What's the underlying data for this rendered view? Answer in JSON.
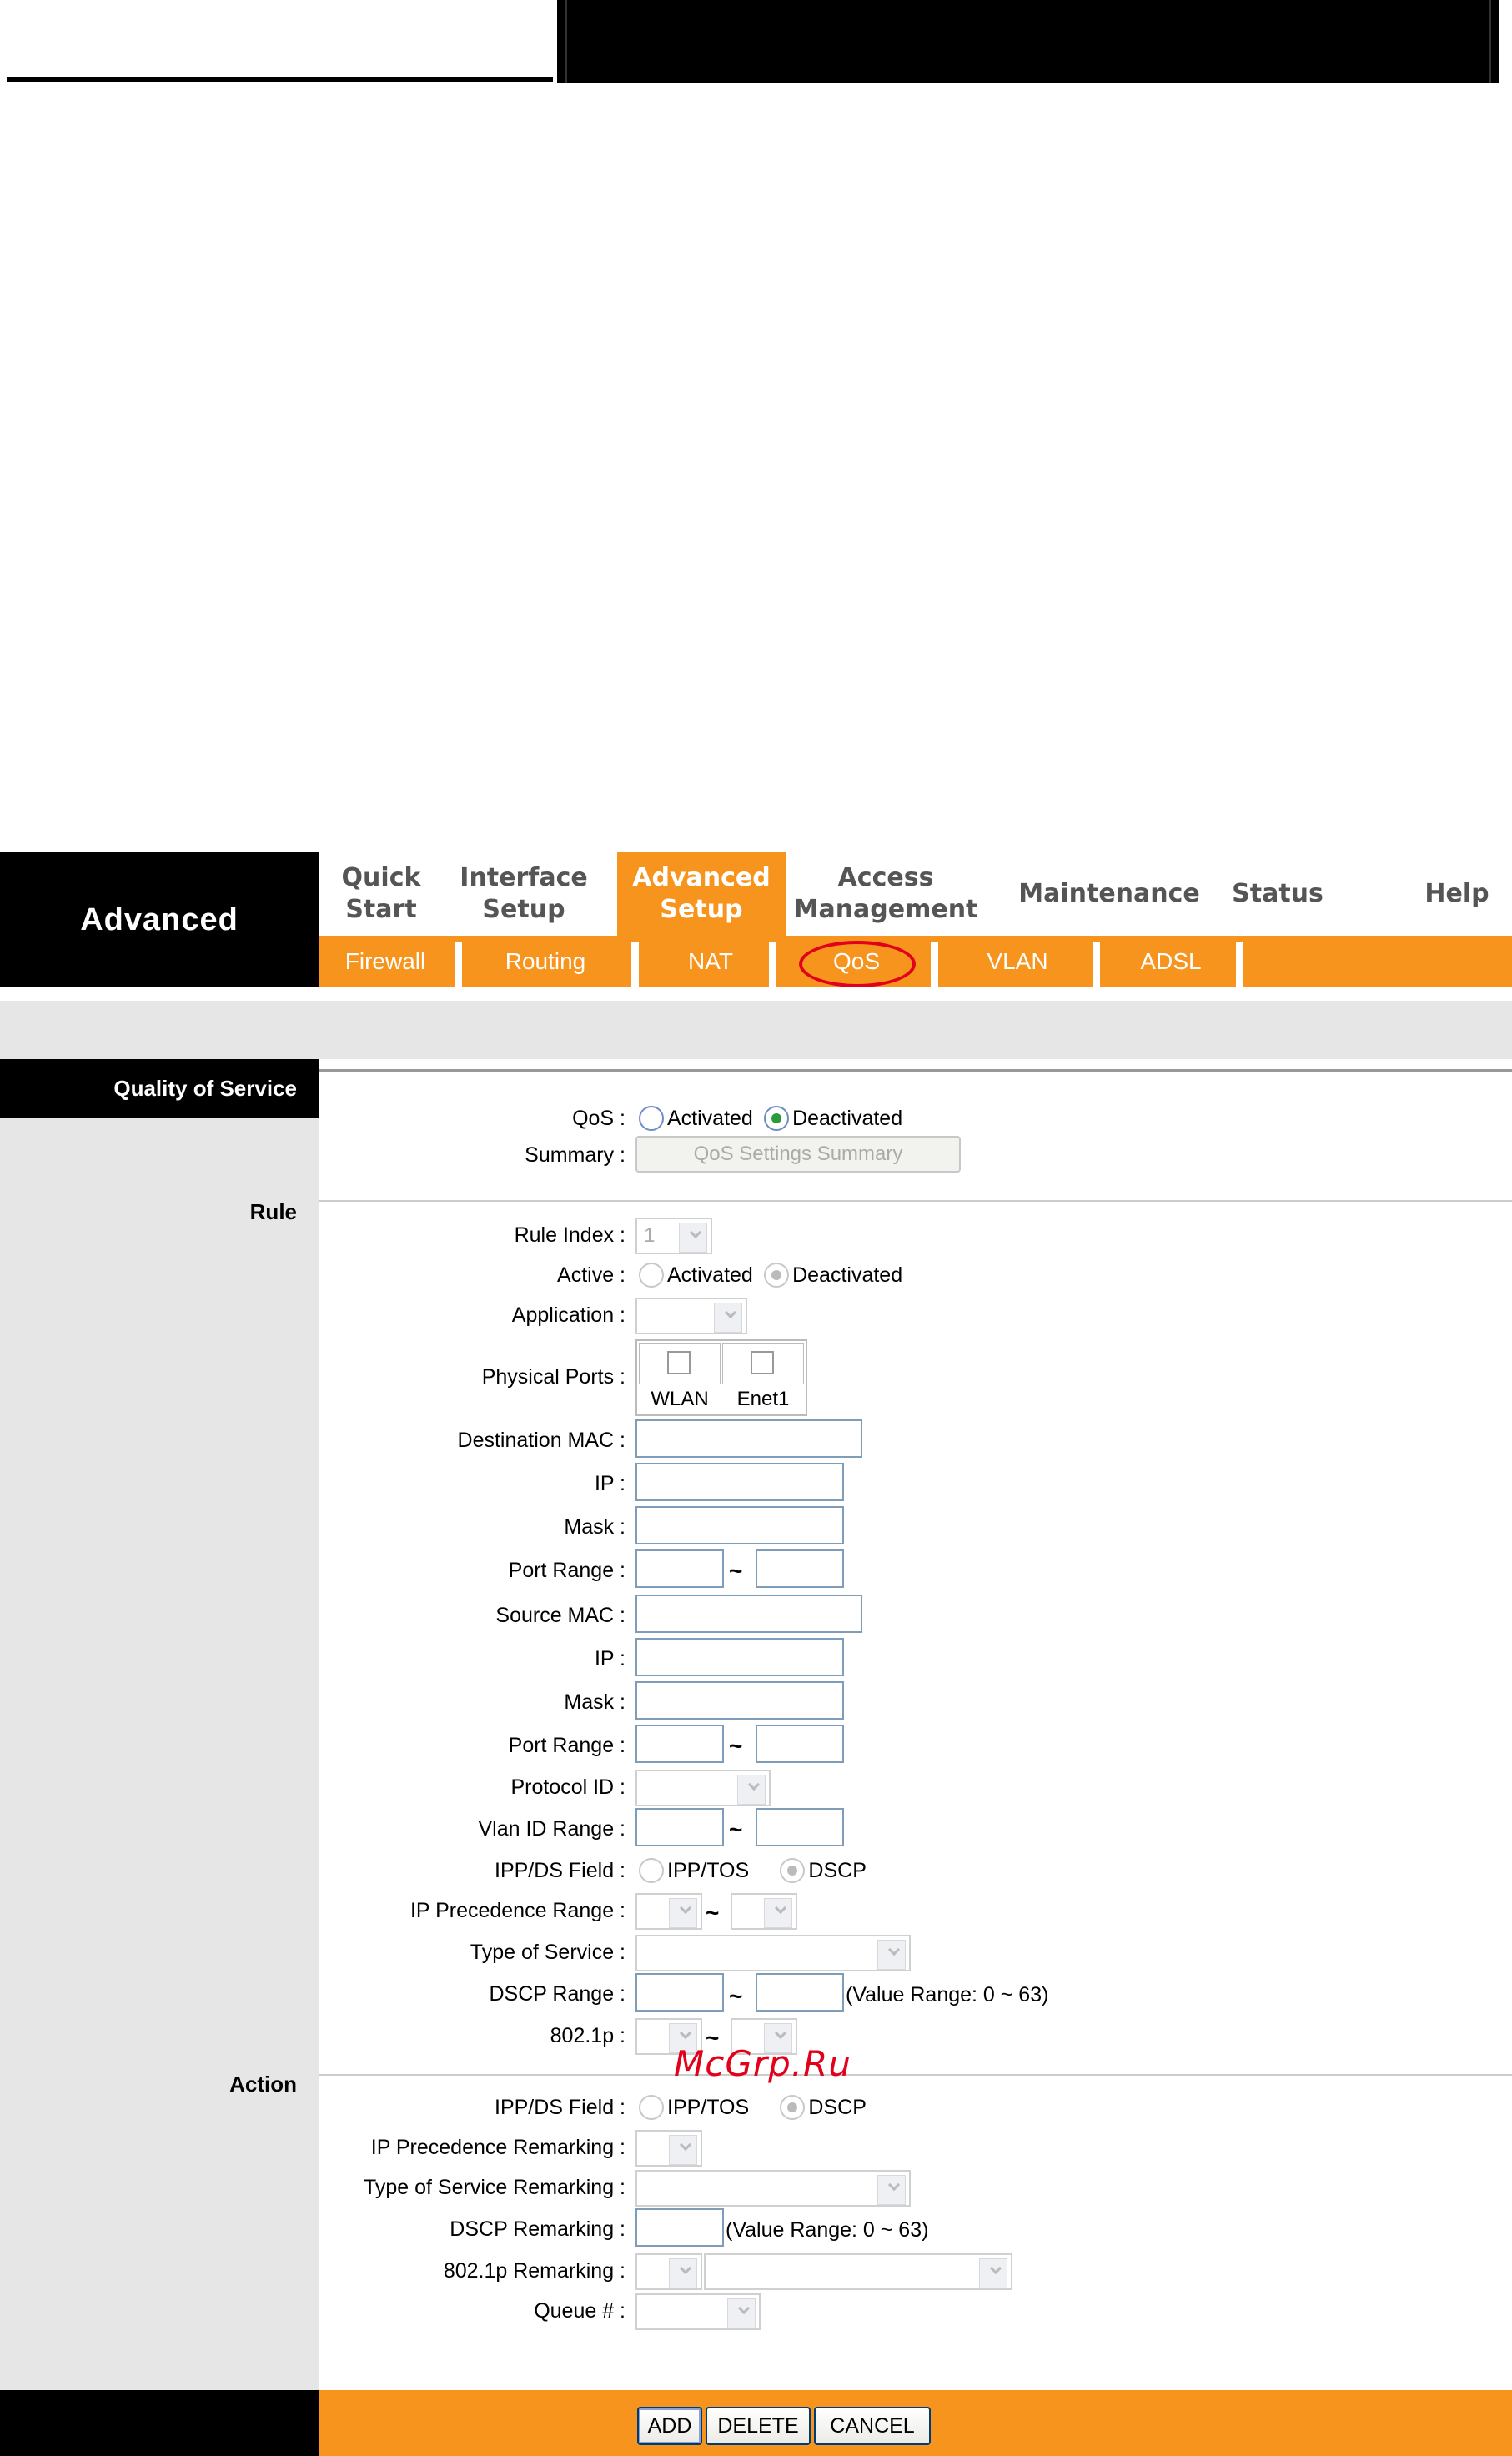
{
  "brand": "Advanced",
  "main_nav": [
    {
      "label": "Quick\nStart",
      "active": false
    },
    {
      "label": "Interface\nSetup",
      "active": false
    },
    {
      "label": "Advanced\nSetup",
      "active": true
    },
    {
      "label": "Access\nManagement",
      "active": false
    },
    {
      "label": "Maintenance",
      "active": false
    },
    {
      "label": "Status",
      "active": false
    },
    {
      "label": "Help",
      "active": false
    }
  ],
  "sub_nav": [
    "Firewall",
    "Routing",
    "NAT",
    "QoS",
    "VLAN",
    "ADSL"
  ],
  "section_title": "Quality of Service",
  "qos": {
    "label": "QoS :",
    "activated": "Activated",
    "deactivated": "Deactivated",
    "summary_label": "Summary :",
    "summary_button": "QoS Settings Summary"
  },
  "rule": {
    "group": "Rule",
    "rule_index_label": "Rule Index :",
    "rule_index_value": "1",
    "active_label": "Active :",
    "activated": "Activated",
    "deactivated": "Deactivated",
    "application_label": "Application :",
    "physical_ports_label": "Physical Ports :",
    "port_wlan": "WLAN",
    "port_enet1": "Enet1",
    "dest_mac_label": "Destination MAC :",
    "ip_label": "IP :",
    "mask_label": "Mask :",
    "port_range_label": "Port Range :",
    "src_mac_label": "Source MAC :",
    "protocol_id_label": "Protocol ID :",
    "vlan_range_label": "Vlan ID Range :",
    "ippds_label": "IPP/DS Field :",
    "ipptos": "IPP/TOS",
    "dscp": "DSCP",
    "ip_prec_label": "IP Precedence Range :",
    "tos_label": "Type of Service :",
    "dscp_range_label": "DSCP Range :",
    "dscp_note": "(Value Range: 0 ~ 63)",
    "dot1p_label": "802.1p :",
    "tilde": "~"
  },
  "action": {
    "group": "Action",
    "ippds_label": "IPP/DS Field :",
    "ipptos": "IPP/TOS",
    "dscp": "DSCP",
    "ip_prec_remark_label": "IP Precedence Remarking :",
    "tos_remark_label": "Type of Service Remarking :",
    "dscp_remark_label": "DSCP Remarking :",
    "dscp_note": "(Value Range: 0 ~ 63)",
    "dot1p_remark_label": "802.1p Remarking :",
    "queue_label": "Queue # :"
  },
  "buttons": {
    "add": "ADD",
    "delete": "DELETE",
    "cancel": "CANCEL"
  },
  "watermark": "McGrp.Ru",
  "colors": {
    "accent": "#f7941d",
    "header": "#000000",
    "panel": "#e6e6e6",
    "highlight_ring": "#e2001a"
  }
}
